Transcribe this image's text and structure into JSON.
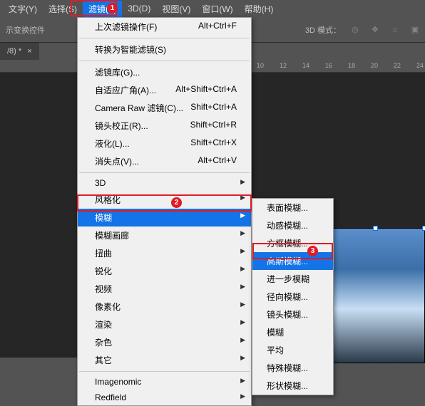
{
  "menubar": {
    "items": [
      "文字(Y)",
      "选择(S)",
      "滤镜(T)",
      "3D(D)",
      "视图(V)",
      "窗口(W)",
      "帮助(H)"
    ],
    "active": 2
  },
  "opt": {
    "label": "示变换控件",
    "mode": "3D 模式："
  },
  "tab": {
    "name": "/8) *",
    "close": "×"
  },
  "ruler": {
    "ticks": [
      "10",
      "12",
      "14",
      "16",
      "18",
      "20",
      "22",
      "24"
    ]
  },
  "dd1": {
    "groups": [
      [
        {
          "l": "上次滤镜操作(F)",
          "s": "Alt+Ctrl+F"
        }
      ],
      [
        {
          "l": "转换为智能滤镜(S)"
        }
      ],
      [
        {
          "l": "滤镜库(G)..."
        },
        {
          "l": "自适应广角(A)...",
          "s": "Alt+Shift+Ctrl+A"
        },
        {
          "l": "Camera Raw 滤镜(C)...",
          "s": "Shift+Ctrl+A"
        },
        {
          "l": "镜头校正(R)...",
          "s": "Shift+Ctrl+R"
        },
        {
          "l": "液化(L)...",
          "s": "Shift+Ctrl+X"
        },
        {
          "l": "消失点(V)...",
          "s": "Alt+Ctrl+V"
        }
      ],
      [
        {
          "l": "3D",
          "sub": true
        },
        {
          "l": "风格化",
          "sub": true
        },
        {
          "l": "模糊",
          "sub": true,
          "hi": true
        },
        {
          "l": "模糊画廊",
          "sub": true
        },
        {
          "l": "扭曲",
          "sub": true
        },
        {
          "l": "锐化",
          "sub": true
        },
        {
          "l": "视频",
          "sub": true
        },
        {
          "l": "像素化",
          "sub": true
        },
        {
          "l": "渲染",
          "sub": true
        },
        {
          "l": "杂色",
          "sub": true
        },
        {
          "l": "其它",
          "sub": true
        }
      ],
      [
        {
          "l": "Imagenomic",
          "sub": true
        },
        {
          "l": "Redfield",
          "sub": true
        }
      ]
    ]
  },
  "dd2": {
    "items": [
      "表面模糊...",
      "动感模糊...",
      "方框模糊...",
      "高斯模糊...",
      "进一步模糊",
      "径向模糊...",
      "镜头模糊...",
      "模糊",
      "平均",
      "特殊模糊...",
      "形状模糊..."
    ],
    "hi": 3
  },
  "markers": {
    "m1": "1",
    "m2": "2",
    "m3": "3"
  }
}
